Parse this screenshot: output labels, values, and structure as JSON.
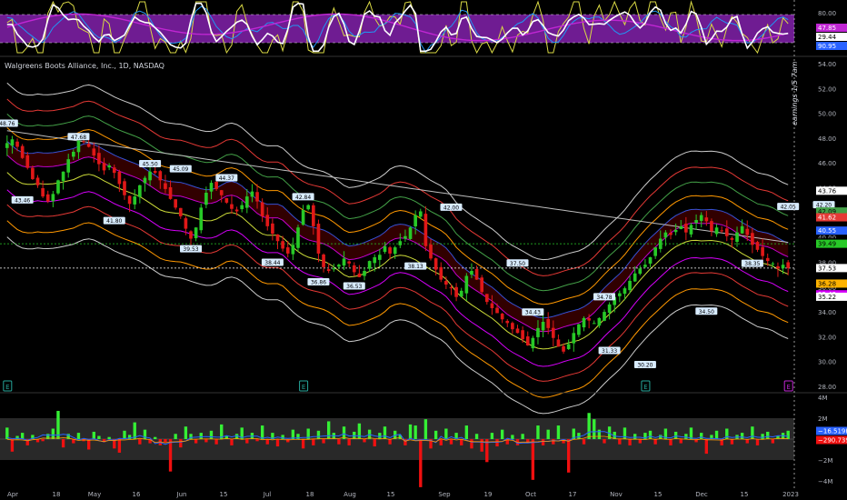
{
  "symbol": "Walgreens Boots Alliance, Inc., 1D, NASDAQ",
  "earnings_note": "earnings 1/5 7am",
  "colors": {
    "background": "#000000",
    "up_candle": "#27c927",
    "down_candle": "#e01818",
    "osc_band": "#7b1fa2",
    "osc_main": "#ffffff",
    "osc_signal": "#c026d3",
    "osc_fast": "#d9d945",
    "osc_blue": "#2196f3",
    "envelope_outer": "#cccccc",
    "envelope_red": "#e53935",
    "envelope_orange": "#ff9800",
    "envelope_yellow": "#cddc39",
    "envelope_green": "#43a047",
    "envelope_blue": "#2962ff",
    "envelope_magenta": "#d500f9",
    "vol_up": "#35f035",
    "vol_down": "#f01010",
    "vol_band": "#3a3a3a"
  },
  "chart_data": [
    {
      "type": "line",
      "name": "oscillator",
      "yticks": [
        "80.00"
      ],
      "labels": [
        "47.85",
        "29.44",
        "90.95"
      ],
      "label_colors": [
        "#c026d3",
        "#ffffff",
        "#2962ff"
      ]
    },
    {
      "type": "candlestick",
      "name": "price",
      "ylim": [
        28,
        54
      ],
      "yticks": [
        "54.00",
        "52.00",
        "50.00",
        "48.00",
        "46.00",
        "44.00",
        "42.00",
        "40.00",
        "38.00",
        "36.00",
        "34.00",
        "32.00",
        "30.00",
        "28.00"
      ],
      "x_labels": [
        "Apr",
        "18",
        "May",
        "16",
        "Jun",
        "15",
        "Jul",
        "18",
        "Aug",
        "15",
        "Sep",
        "19",
        "Oct",
        "17",
        "Nov",
        "15",
        "Dec",
        "15",
        "2023"
      ],
      "last": 37.53,
      "reference_level": 39.49,
      "closes": [
        47.6,
        47.9,
        47.3,
        46.4,
        45.6,
        44.7,
        44.2,
        43.3,
        42.9,
        43.5,
        44.6,
        45.3,
        46.3,
        46.9,
        47.8,
        47.7,
        47.3,
        46.6,
        45.9,
        45.4,
        45.8,
        45.2,
        44.3,
        43.4,
        42.7,
        43.3,
        44.2,
        44.8,
        45.3,
        45.2,
        44.6,
        43.9,
        43.1,
        42.4,
        41.7,
        40.7,
        39.9,
        40.8,
        42.4,
        43.6,
        44.4,
        43.9,
        43.4,
        42.8,
        42.3,
        42.1,
        42.6,
        43.3,
        43.7,
        42.9,
        41.7,
        40.9,
        40.3,
        39.7,
        39.1,
        38.7,
        39.4,
        40.8,
        42.2,
        42.6,
        40.9,
        38.7,
        37.6,
        37.3,
        37.5,
        37.8,
        38.3,
        37.9,
        37.2,
        36.8,
        37.3,
        38.1,
        38.4,
        38.6,
        39.3,
        38.7,
        39.2,
        39.7,
        40.1,
        40.8,
        41.8,
        42.1,
        39.3,
        38.3,
        37.4,
        36.6,
        36.2,
        35.9,
        35.2,
        35.7,
        36.9,
        37.3,
        36.6,
        35.6,
        34.8,
        34.3,
        33.9,
        33.4,
        33.1,
        32.6,
        32.3,
        31.8,
        31.3,
        31.9,
        32.7,
        33.2,
        32.7,
        31.9,
        31.2,
        30.8,
        31.4,
        32.3,
        33.0,
        33.5,
        33.3,
        33.1,
        33.5,
        34.0,
        34.6,
        35.2,
        35.5,
        35.9,
        36.5,
        37.1,
        37.5,
        37.8,
        38.4,
        39.2,
        39.9,
        40.4,
        40.2,
        40.6,
        40.9,
        40.4,
        41.0,
        41.4,
        41.8,
        41.3,
        40.5,
        40.8,
        40.5,
        40.1,
        39.8,
        40.4,
        40.9,
        40.2,
        39.4,
        39.0,
        38.5,
        38.1,
        37.9,
        37.5,
        37.8,
        37.53
      ],
      "volume": {
        "yticks": [
          "4M",
          "2M",
          "0",
          "−2M",
          "−4M"
        ],
        "labels": [
          "−16.519K",
          "−290.739K"
        ],
        "label_colors": [
          "#2962ff",
          "#f01010"
        ],
        "values": [
          1.1,
          -1.2,
          0.3,
          0.6,
          -0.6,
          0.4,
          -0.3,
          -0.2,
          0.5,
          1.0,
          2.7,
          -0.8,
          0.5,
          -0.4,
          0.6,
          -0.2,
          -1.0,
          0.7,
          0.3,
          -0.3,
          0.2,
          -0.9,
          -1.3,
          0.8,
          0.4,
          1.6,
          -0.5,
          0.9,
          -0.4,
          0.2,
          -0.6,
          -0.3,
          -3.1,
          0.5,
          -0.8,
          1.2,
          0.5,
          -0.4,
          0.6,
          -0.3,
          0.8,
          -0.5,
          1.4,
          0.3,
          -0.6,
          0.5,
          1.1,
          -0.4,
          0.6,
          -0.2,
          1.3,
          -0.5,
          0.6,
          -0.7,
          0.4,
          -0.3,
          0.9,
          0.5,
          -0.9,
          1.0,
          -0.6,
          0.8,
          -0.4,
          1.7,
          0.6,
          -0.5,
          1.2,
          -0.6,
          0.7,
          1.5,
          -0.3,
          0.9,
          -0.7,
          0.6,
          1.2,
          -0.5,
          0.8,
          0.4,
          -0.6,
          1.4,
          1.3,
          -4.6,
          1.9,
          -0.9,
          0.8,
          -0.6,
          1.0,
          -0.5,
          0.6,
          -0.6,
          1.3,
          -0.9,
          0.5,
          -1.2,
          -2.2,
          0.6,
          -0.7,
          0.9,
          -0.5,
          0.4,
          -0.6,
          0.5,
          -0.4,
          -3.9,
          1.3,
          -0.6,
          0.9,
          -0.5,
          1.3,
          -0.4,
          -3.2,
          1.0,
          0.6,
          -0.5,
          2.5,
          1.9,
          0.9,
          -0.4,
          1.2,
          0.7,
          -0.5,
          1.1,
          -0.6,
          0.5,
          -0.4,
          0.6,
          0.8,
          -0.5,
          0.4,
          1.0,
          -0.6,
          0.7,
          -0.4,
          0.5,
          1.1,
          -0.3,
          0.6,
          -1.4,
          0.4,
          0.8,
          -0.6,
          1.0,
          -0.5,
          0.4,
          0.6,
          -0.4,
          1.2,
          -0.6,
          0.5,
          0.7,
          -0.4,
          0.3,
          0.6,
          0.8
        ]
      },
      "right_labels": [
        {
          "text": "43.76",
          "value": 43.76,
          "bg": "#ffffff",
          "fg": "#000000"
        },
        {
          "text": "42.09",
          "value": 42.09,
          "bg": "#43a047",
          "fg": "#000000"
        },
        {
          "text": "41.62",
          "value": 41.62,
          "bg": "#e53935",
          "fg": "#ffffff"
        },
        {
          "text": "40.55",
          "value": 40.55,
          "bg": "#2962ff",
          "fg": "#ffffff"
        },
        {
          "text": "39.60",
          "value": 39.6,
          "bg": "#000000",
          "fg": "#ffffff"
        },
        {
          "text": "39.49",
          "value": 39.49,
          "bg": "#27c927",
          "fg": "#000000"
        },
        {
          "text": "35.42",
          "value": 35.42,
          "bg": "#d500f9",
          "fg": "#ffffff"
        },
        {
          "text": "37.53",
          "value": 37.53,
          "bg": "#ffffff",
          "fg": "#000000"
        },
        {
          "text": "36.28",
          "value": 36.28,
          "bg": "#ffb300",
          "fg": "#000000"
        },
        {
          "text": "35.22",
          "value": 35.22,
          "bg": "#ffffff",
          "fg": "#000000"
        }
      ],
      "price_tags": [
        {
          "i": 0,
          "v": 48.76,
          "text": "48.76",
          "pos": "above"
        },
        {
          "i": 3,
          "v": 43.46,
          "text": "43.46",
          "pos": "below"
        },
        {
          "i": 14,
          "v": 47.68,
          "text": "47.68",
          "pos": "above"
        },
        {
          "i": 21,
          "v": 41.8,
          "text": "41.80",
          "pos": "below"
        },
        {
          "i": 28,
          "v": 45.5,
          "text": "45.50",
          "pos": "above"
        },
        {
          "i": 34,
          "v": 45.09,
          "text": "45.09",
          "pos": "above"
        },
        {
          "i": 36,
          "v": 39.53,
          "text": "39.53",
          "pos": "below"
        },
        {
          "i": 43,
          "v": 44.37,
          "text": "44.37",
          "pos": "above"
        },
        {
          "i": 52,
          "v": 38.44,
          "text": "38.44",
          "pos": "below"
        },
        {
          "i": 58,
          "v": 42.84,
          "text": "42.84",
          "pos": "above"
        },
        {
          "i": 61,
          "v": 36.86,
          "text": "36.86",
          "pos": "below"
        },
        {
          "i": 68,
          "v": 36.53,
          "text": "36.53",
          "pos": "below"
        },
        {
          "i": 80,
          "v": 38.13,
          "text": "38.13",
          "pos": "below"
        },
        {
          "i": 87,
          "v": 42.0,
          "text": "42.00",
          "pos": "above"
        },
        {
          "i": 100,
          "v": 37.5,
          "text": "37.50",
          "pos": "above"
        },
        {
          "i": 103,
          "v": 34.43,
          "text": "34.43",
          "pos": "below"
        },
        {
          "i": 117,
          "v": 34.78,
          "text": "34.78",
          "pos": "above"
        },
        {
          "i": 118,
          "v": 31.33,
          "text": "31.33",
          "pos": "below"
        },
        {
          "i": 125,
          "v": 30.2,
          "text": "30.20",
          "pos": "below"
        },
        {
          "i": 137,
          "v": 34.5,
          "text": "34.50",
          "pos": "below"
        },
        {
          "i": 146,
          "v": 38.35,
          "text": "38.35",
          "pos": "below"
        },
        {
          "i": 153,
          "v": 42.05,
          "text": "42.05",
          "pos": "above"
        },
        {
          "i": 160,
          "v": 42.2,
          "text": "42.20",
          "pos": "above"
        }
      ],
      "markers": [
        {
          "i": 0,
          "text": "E"
        },
        {
          "i": 58,
          "text": "E"
        },
        {
          "i": 125,
          "text": "E"
        },
        {
          "i": 174,
          "text": "E"
        }
      ]
    }
  ]
}
